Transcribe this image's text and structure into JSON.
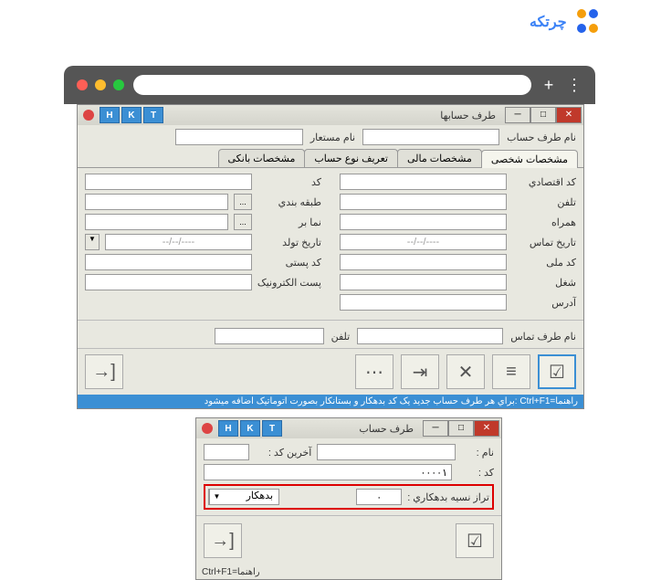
{
  "logo": {
    "text": "چرتکه"
  },
  "window1": {
    "title": "طرف حسابها",
    "toolbar_letters": [
      "H",
      "K",
      "T"
    ],
    "row_labels": {
      "account_name": "نام طرف حساب",
      "alias": "نام مستعار"
    },
    "tabs": [
      "مشخصات شخصی",
      "مشخصات مالی",
      "تعریف نوع حساب",
      "مشخصات بانکی"
    ],
    "right_col": {
      "economic_code": "کد اقتصادي",
      "phone": "تلفن",
      "mobile": "همراه",
      "contact_date": "تاریخ تماس",
      "national_id": "کد ملی",
      "job": "شغل",
      "address": "آدرس"
    },
    "left_col": {
      "code": "کد",
      "category": "طبقه بندي",
      "agent": "نما بر",
      "birth_date": "تاریخ تولد",
      "postal_code": "کد پستی",
      "email": "پست الکترونیک"
    },
    "date_placeholder": "----/--/--",
    "bottom": {
      "contact_name": "نام طرف تماس",
      "phone": "تلفن"
    },
    "status": "راهنما=Ctrl+F1 :براي هر طرف حساب جدید یک کد بدهکار و بستانکار بصورت اتوماتیک اضافه میشود"
  },
  "window2": {
    "title": "طرف حساب",
    "toolbar_letters": [
      "H",
      "K",
      "T"
    ],
    "labels": {
      "name": "نام :",
      "last_code": "آخرین کد :",
      "code": "کد :",
      "balance": "تراز نسیه بدهکاري :"
    },
    "values": {
      "code": "۰۰۰۰۱",
      "balance": "۰",
      "dropdown": "بدهکار"
    },
    "status": "راهنما=Ctrl+F1"
  }
}
